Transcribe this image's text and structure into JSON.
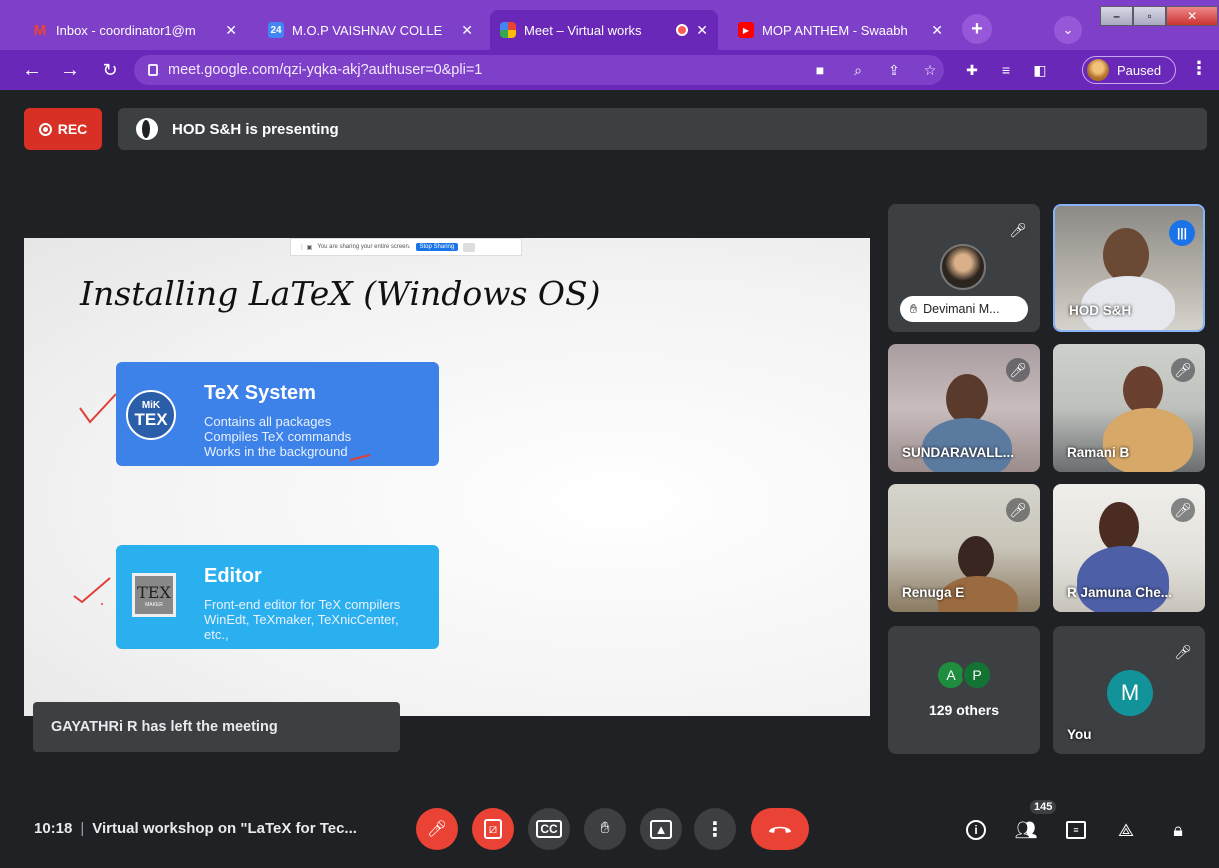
{
  "browser": {
    "tabs": [
      {
        "title": "Inbox - coordinator1@m",
        "favicon": "gmail-icon",
        "color": "#ea4335"
      },
      {
        "title": "M.O.P VAISHNAV COLLE",
        "favicon": "calendar-icon",
        "color": "#4285f4"
      },
      {
        "title": "Meet – Virtual works",
        "favicon": "meet-icon",
        "color": "#00ac47",
        "active": true
      },
      {
        "title": "MOP ANTHEM - Swaabh",
        "favicon": "youtube-icon",
        "color": "#ff0000"
      }
    ],
    "url": "meet.google.com/qzi-yqka-akj?authuser=0&pli=1",
    "profile_status": "Paused"
  },
  "meet": {
    "rec_label": "REC",
    "presenting_text": "HOD S&H is presenting",
    "toast": "GAYATHRi R has left the meeting",
    "time": "10:18",
    "meeting_title": "Virtual workshop on \"LaTeX for Tec...",
    "participant_count": "145"
  },
  "slide": {
    "sharebar_text": "You are sharing your entire screen.",
    "sharebar_stop": "Stop Sharing",
    "title": "Installing LaTeX (Windows OS)",
    "cards": [
      {
        "title": "TeX System",
        "icon_top": "MiK",
        "icon_bottom": "TEX",
        "lines": [
          "Contains all packages",
          "Compiles TeX commands",
          "Works in the background"
        ]
      },
      {
        "title": "Editor",
        "icon_top": "TEX",
        "icon_bottom": "MAKER",
        "lines": [
          "Front-end editor for TeX compilers",
          "WinEdt,  TeXmaker,  TeXnicCenter,",
          "etc.,"
        ]
      }
    ]
  },
  "participants": [
    {
      "name": "Devimani M...",
      "type": "avatar"
    },
    {
      "name": "HOD S&H",
      "type": "video",
      "speaking": true
    },
    {
      "name": "SUNDARAVALL...",
      "type": "video"
    },
    {
      "name": "Ramani B",
      "type": "video"
    },
    {
      "name": "Renuga E",
      "type": "video"
    },
    {
      "name": "R Jamuna Che...",
      "type": "video"
    },
    {
      "others_initials": [
        "A",
        "P"
      ],
      "others_colors": [
        "#1e8e3e",
        "#137333"
      ],
      "others_label": "129 others"
    },
    {
      "name": "You",
      "initial": "M"
    }
  ]
}
